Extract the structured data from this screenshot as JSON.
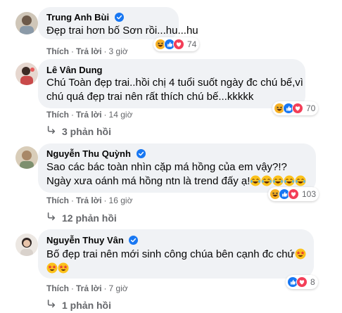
{
  "comments": [
    {
      "name": "Trung Anh Bùi",
      "verified": true,
      "text": "Đẹp trai hơn bố Sơn rồi...hu...hu",
      "like": "Thích",
      "reply": "Trả lời",
      "time": "3 giờ",
      "reaction_count": "74",
      "reactions": [
        "haha-icon",
        "like-icon",
        "love-icon"
      ]
    },
    {
      "name": "Lê Vân Dung",
      "verified": false,
      "text_line1": "Chú Toàn đẹp trai..hồi chị 4 tuổi suốt ngày đc chú bế,vì",
      "text_line2": "chú quá đẹp trai nên rất thích chú bế...kkkkk",
      "like": "Thích",
      "reply": "Trả lời",
      "time": "14 giờ",
      "reaction_count": "70",
      "reactions": [
        "haha-icon",
        "like-icon",
        "love-icon"
      ],
      "replies_label": "3 phản hồi"
    },
    {
      "name": "Nguyễn Thu Quỳnh",
      "verified": true,
      "text_line1": "Sao các bác toàn nhìn cặp má hồng của em vậy?!?",
      "text_line2": "Ngày xưa oánh má hồng ntn là trend đấy ạ!",
      "like": "Thích",
      "reply": "Trả lời",
      "time": "16 giờ",
      "reaction_count": "103",
      "reactions": [
        "haha-icon",
        "like-icon",
        "love-icon"
      ],
      "inline_emojis": [
        "laughing-crying-emoji",
        "laughing-crying-emoji",
        "laughing-crying-emoji",
        "laughing-crying-emoji",
        "laughing-crying-emoji"
      ],
      "replies_label": "12 phản hồi"
    },
    {
      "name": "Nguyễn Thuy Vân",
      "verified": true,
      "text_line1": "Bố đẹp trai nên mới sinh công chúa bên cạnh đc chứ",
      "like": "Thích",
      "reply": "Trả lời",
      "time": "7 giờ",
      "reaction_count": "8",
      "reactions": [
        "like-icon",
        "love-icon"
      ],
      "inline_emojis": [
        "star-struck-emoji",
        "star-struck-emoji",
        "star-struck-emoji"
      ],
      "replies_label": "1 phản hồi"
    }
  ],
  "colors": {
    "bubble": "#f0f2f5",
    "meta_text": "#65676b",
    "like_blue": "#1877f2",
    "love_red": "#f33e58",
    "haha_yellow": "#f7b125"
  }
}
